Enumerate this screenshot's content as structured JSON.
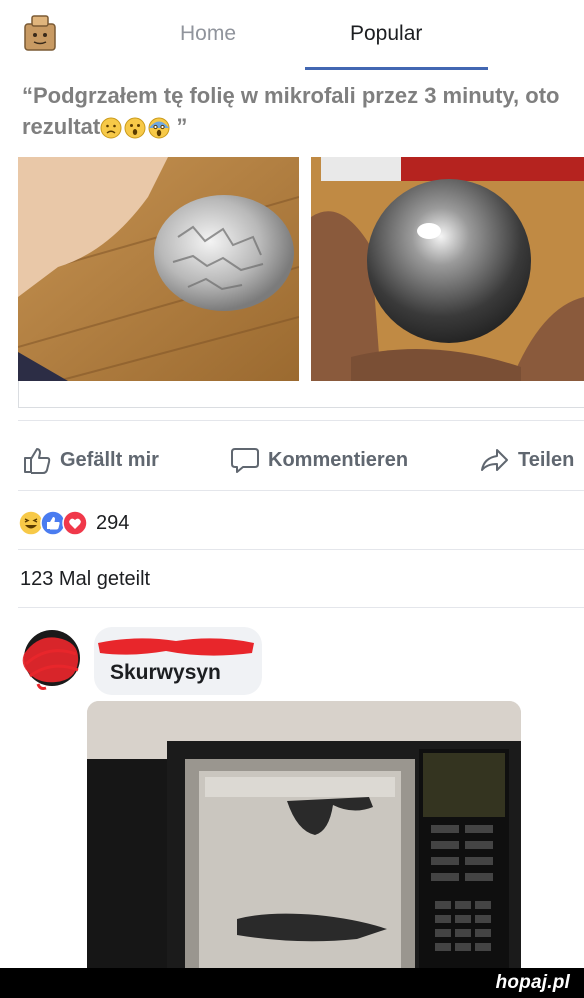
{
  "nav": {
    "home_label": "Home",
    "popular_label": "Popular",
    "active_tab": "Popular"
  },
  "post": {
    "quote_text": "“Podgrzałem tę folię w mikrofali przez 3 minuty, oto rezultat",
    "quote_close": "”",
    "quote_emojis": [
      "worried-face-emoji",
      "astonished-face-emoji",
      "screaming-face-emoji"
    ],
    "photos": [
      {
        "name": "crumpled-foil-ball-photo"
      },
      {
        "name": "shiny-metal-sphere-photo"
      }
    ]
  },
  "actions": {
    "like_label": "Gefällt mir",
    "comment_label": "Kommentieren",
    "share_label": "Teilen"
  },
  "reactions": {
    "icons": [
      "haha-icon",
      "like-icon",
      "love-icon"
    ],
    "count": "294"
  },
  "shares": {
    "text": "123 Mal geteilt"
  },
  "comment": {
    "author": "Skurwysyn",
    "image_name": "burnt-microwave-photo"
  },
  "watermark": {
    "text": "hopaj.pl"
  },
  "colors": {
    "accent": "#4267b2",
    "quote_gray": "#7f7f7f",
    "action_gray": "#606770",
    "redact_red": "#e8262b"
  }
}
